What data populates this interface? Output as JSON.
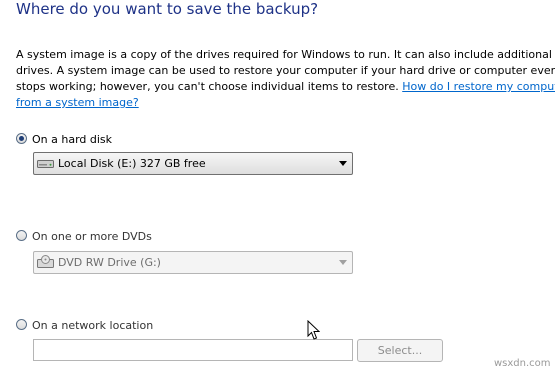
{
  "header": {
    "title": "Where do you want to save the backup?"
  },
  "description": {
    "line1": "A system image is a copy of the drives required for Windows to run. It can also include additional",
    "line2": "drives. A system image can be used to restore your computer if your hard drive or computer ever",
    "line3_text": "stops working; however, you can't choose individual items to restore. ",
    "line3_link": "How do I restore my computer",
    "line4_link": "from a system image?"
  },
  "options": {
    "hard_disk": {
      "label": "On a hard disk",
      "selected": true,
      "drive_value": "Local Disk (E:)  327 GB free",
      "drive_icon": "hard-drive-icon"
    },
    "dvd": {
      "label": "On one or more DVDs",
      "selected": false,
      "drive_value": "DVD RW Drive (G:)",
      "drive_icon": "dvd-drive-icon"
    },
    "network": {
      "label": "On a network location",
      "selected": false,
      "location_value": "",
      "select_button_label": "Select..."
    }
  },
  "watermark": "wsxdn.com"
}
